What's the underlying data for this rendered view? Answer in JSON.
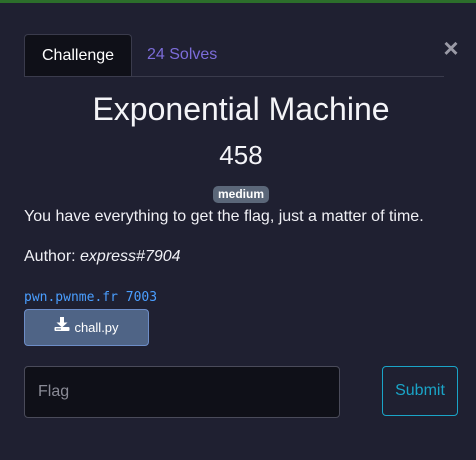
{
  "modal": {
    "close_glyph": "×",
    "tabs": [
      {
        "label": "Challenge",
        "active": true
      },
      {
        "label": "24 Solves",
        "active": false
      }
    ],
    "title": "Exponential Machine",
    "points": "458",
    "difficulty": "medium",
    "description": "You have everything to get the flag, just a matter of time.",
    "author_prefix": "Author: ",
    "author_name": "express#7904",
    "connection": "pwn.pwnme.fr 7003",
    "file": {
      "label": "chall.py",
      "icon": "download-icon"
    },
    "flag_input": {
      "placeholder": "Flag",
      "value": ""
    },
    "submit_label": "Submit"
  },
  "colors": {
    "background": "#1f2031",
    "tab_active_bg": "#0f1018",
    "solves_tab": "#7c6cd9",
    "badge": "#5b6779",
    "connection_link": "#4a9eff",
    "file_button": "#4f6486",
    "submit_outline": "#1aa4c7"
  }
}
